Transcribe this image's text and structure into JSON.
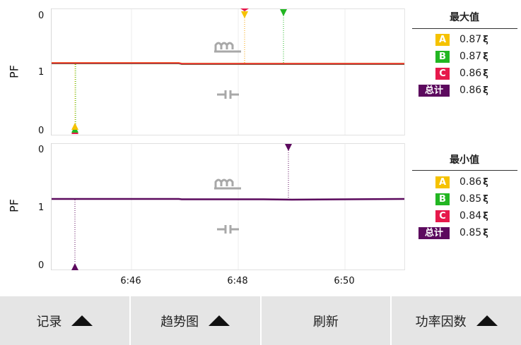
{
  "axis_name": "PF",
  "top_panel": {
    "y_ticks": [
      "0",
      "1",
      "0"
    ],
    "legend_title": "最大值",
    "legend": [
      {
        "label": "A",
        "value": "0.87",
        "sym": "ξ",
        "color": "#f5c200"
      },
      {
        "label": "B",
        "value": "0.87",
        "sym": "ξ",
        "color": "#22b622"
      },
      {
        "label": "C",
        "value": "0.86",
        "sym": "ξ",
        "color": "#e6194b"
      },
      {
        "label": "总计",
        "value": "0.86",
        "sym": "ξ",
        "color": "#5c0a5e"
      }
    ]
  },
  "bottom_panel": {
    "y_ticks": [
      "0",
      "1",
      "0"
    ],
    "legend_title": "最小值",
    "legend": [
      {
        "label": "A",
        "value": "0.86",
        "sym": "ξ",
        "color": "#f5c200"
      },
      {
        "label": "B",
        "value": "0.85",
        "sym": "ξ",
        "color": "#22b622"
      },
      {
        "label": "C",
        "value": "0.84",
        "sym": "ξ",
        "color": "#e6194b"
      },
      {
        "label": "总计",
        "value": "0.85",
        "sym": "ξ",
        "color": "#5c0a5e"
      }
    ]
  },
  "x_ticks": [
    "6:46",
    "6:48",
    "6:50"
  ],
  "icons": {
    "inductive": "inductor-icon",
    "capacitive": "capacitor-icon"
  },
  "colors": {
    "phase_a": "#f5c200",
    "phase_b": "#22b622",
    "phase_c": "#e6194b",
    "total": "#5c0a5e",
    "bar_bg": "#e5e5e5"
  },
  "toolbar": {
    "record_label": "记录",
    "trend_label": "趋势图",
    "refresh_label": "刷新",
    "pf_label": "功率因数"
  }
}
